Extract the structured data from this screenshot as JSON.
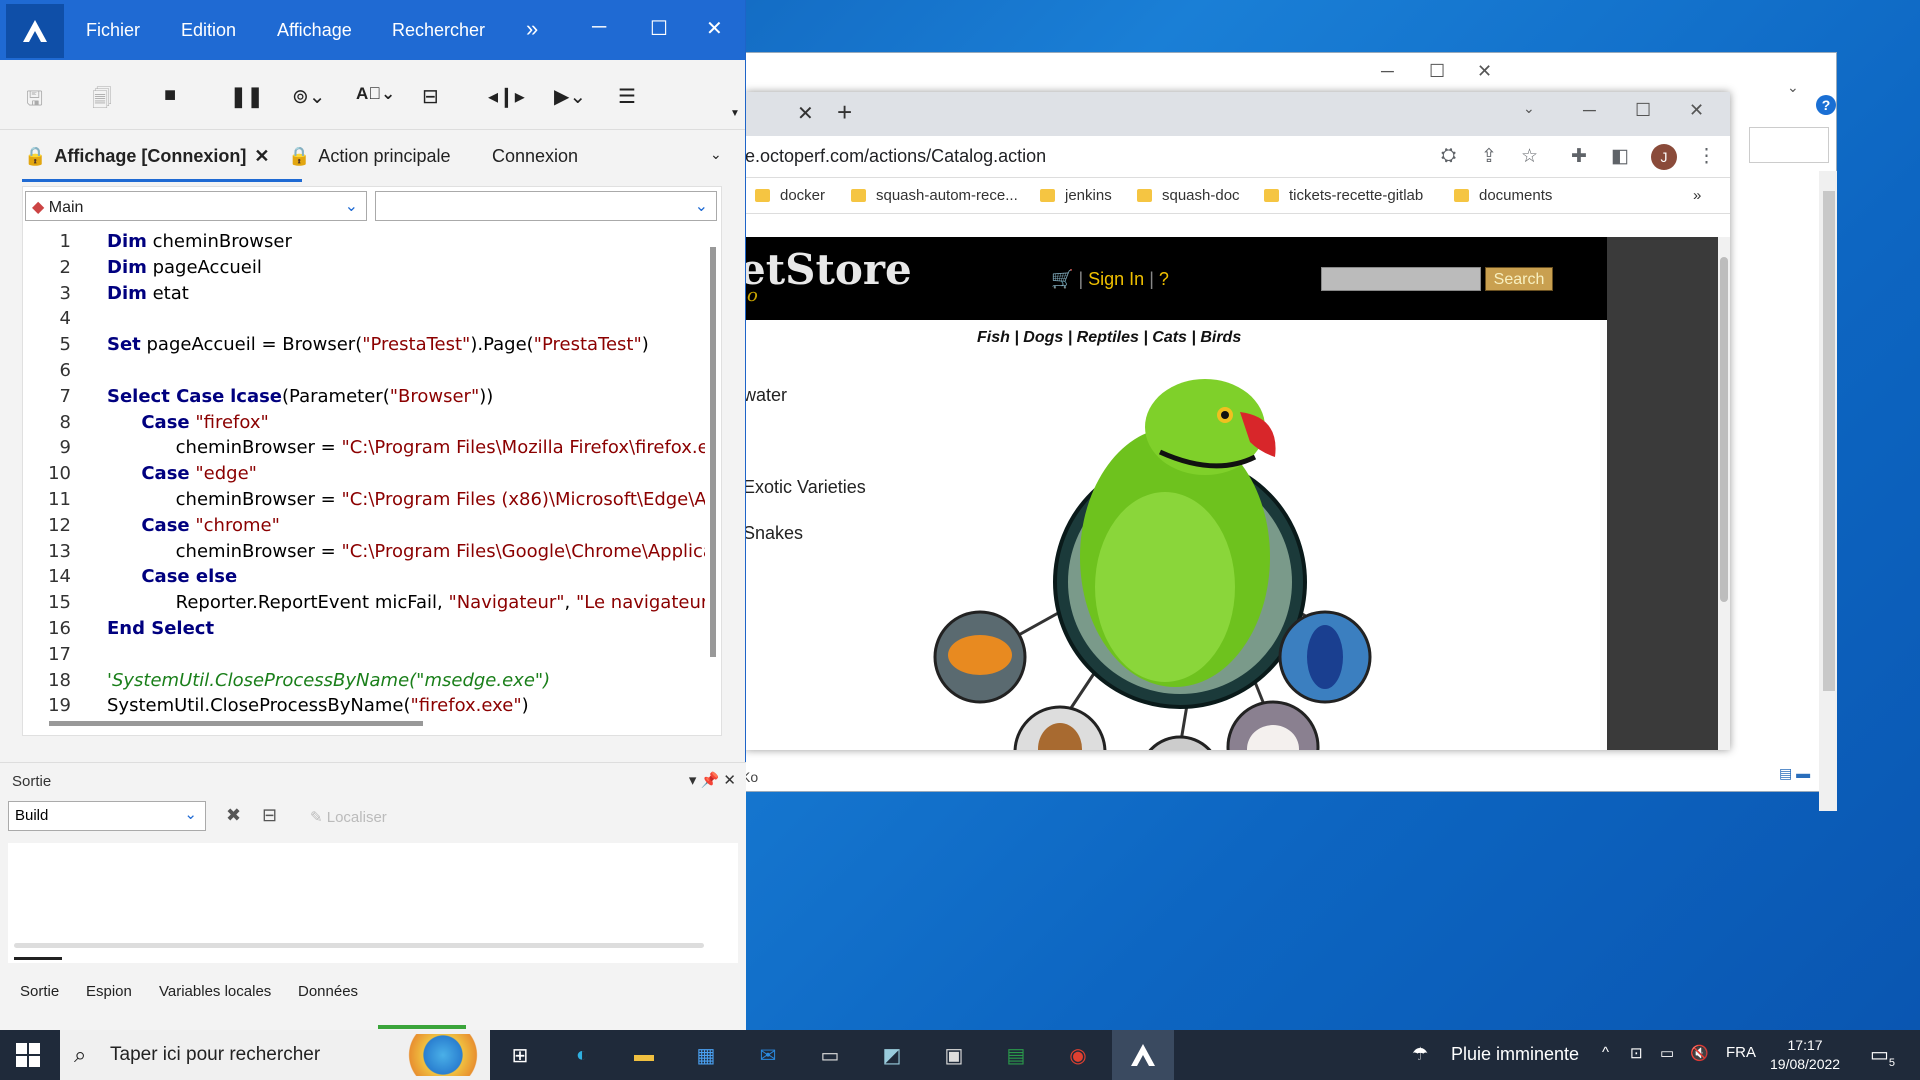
{
  "ide": {
    "menu": [
      "Fichier",
      "Edition",
      "Affichage",
      "Rechercher"
    ],
    "menu_more": "»",
    "tabs": [
      {
        "label": "Affichage [Connexion]",
        "closable": true,
        "locked": true
      },
      {
        "label": "Action principale",
        "locked": true
      },
      {
        "label": "Connexion",
        "locked": false
      }
    ],
    "scope_combo": "Main",
    "method_combo": "",
    "code_lines": [
      {
        "n": "1",
        "html": "<span class='kw'>Dim</span> cheminBrowser"
      },
      {
        "n": "2",
        "html": "<span class='kw'>Dim</span> pageAccueil"
      },
      {
        "n": "3",
        "html": "<span class='kw'>Dim</span> etat"
      },
      {
        "n": "4",
        "html": ""
      },
      {
        "n": "5",
        "html": "<span class='kw'>Set</span> pageAccueil = Browser(<span class='str'>\"PrestaTest\"</span>).Page(<span class='str'>\"PrestaTest\"</span>)"
      },
      {
        "n": "6",
        "html": ""
      },
      {
        "n": "7",
        "html": "<span class='kw'>Select Case</span> <span class='kw'>lcase</span>(Parameter(<span class='str'>\"Browser\"</span>))"
      },
      {
        "n": "8",
        "html": "&nbsp;&nbsp;&nbsp;&nbsp;&nbsp;&nbsp;<span class='kw'>Case</span> <span class='str'>\"firefox\"</span>"
      },
      {
        "n": "9",
        "html": "&nbsp;&nbsp;&nbsp;&nbsp;&nbsp;&nbsp;&nbsp;&nbsp;&nbsp;&nbsp;&nbsp;&nbsp;cheminBrowser = <span class='str'>\"C:\\Program Files\\Mozilla Firefox\\firefox.exe</span>"
      },
      {
        "n": "10",
        "html": "&nbsp;&nbsp;&nbsp;&nbsp;&nbsp;&nbsp;<span class='kw'>Case</span> <span class='str'>\"edge\"</span>"
      },
      {
        "n": "11",
        "html": "&nbsp;&nbsp;&nbsp;&nbsp;&nbsp;&nbsp;&nbsp;&nbsp;&nbsp;&nbsp;&nbsp;&nbsp;cheminBrowser = <span class='str'>\"C:\\Program Files (x86)\\Microsoft\\Edge\\App</span>"
      },
      {
        "n": "12",
        "html": "&nbsp;&nbsp;&nbsp;&nbsp;&nbsp;&nbsp;<span class='kw'>Case</span> <span class='str'>\"chrome\"</span>"
      },
      {
        "n": "13",
        "html": "&nbsp;&nbsp;&nbsp;&nbsp;&nbsp;&nbsp;&nbsp;&nbsp;&nbsp;&nbsp;&nbsp;&nbsp;cheminBrowser = <span class='str'>\"C:\\Program Files\\Google\\Chrome\\Applicati</span>"
      },
      {
        "n": "14",
        "html": "&nbsp;&nbsp;&nbsp;&nbsp;&nbsp;&nbsp;<span class='kw'>Case else</span>"
      },
      {
        "n": "15",
        "html": "&nbsp;&nbsp;&nbsp;&nbsp;&nbsp;&nbsp;&nbsp;&nbsp;&nbsp;&nbsp;&nbsp;&nbsp;Reporter.ReportEvent micFail, <span class='str'>\"Navigateur\"</span>, <span class='str'>\"Le navigateur \"</span> &amp;"
      },
      {
        "n": "16",
        "html": "<span class='kw'>End Select</span>"
      },
      {
        "n": "17",
        "html": ""
      },
      {
        "n": "18",
        "html": "<span class='cmt'>'SystemUtil.CloseProcessByName(\"msedge.exe\")</span>"
      },
      {
        "n": "19",
        "html": "SystemUtil.CloseProcessByName(<span class='str'>\"firefox.exe\"</span>)"
      }
    ],
    "output": {
      "title": "Sortie",
      "build_combo": "Build",
      "localiser": "Localiser",
      "bottom_tabs": [
        "Sortie",
        "Espion",
        "Variables locales",
        "Données"
      ]
    }
  },
  "chrome": {
    "url": "e.octoperf.com/actions/Catalog.action",
    "avatar_letter": "J",
    "bookmarks": [
      "docker",
      "squash-autom-rece...",
      "jenkins",
      "squash-doc",
      "tickets-recette-gitlab",
      "documents"
    ],
    "bookmarks_more": "»",
    "page": {
      "logo": "etStore",
      "logo_sub": "o",
      "signin": "Sign In",
      "help": "?",
      "search_button": "Search",
      "categories": [
        "Fish",
        "Dogs",
        "Reptiles",
        "Cats",
        "Birds"
      ],
      "side_links": [
        "water",
        "Exotic Varieties",
        "Snakes"
      ]
    }
  },
  "explorer": {
    "status_size": "Ko",
    "help": "?"
  },
  "taskbar": {
    "search_placeholder": "Taper ici pour rechercher",
    "weather": "Pluie imminente",
    "lang": "FRA",
    "time": "17:17",
    "date": "19/08/2022",
    "notifications": "5"
  },
  "colors": {
    "ide_blue": "#1f6ad3",
    "keyword": "#00007f",
    "string": "#8b0000",
    "comment": "#1a7f1a",
    "petstore_gold": "#f0c000"
  }
}
